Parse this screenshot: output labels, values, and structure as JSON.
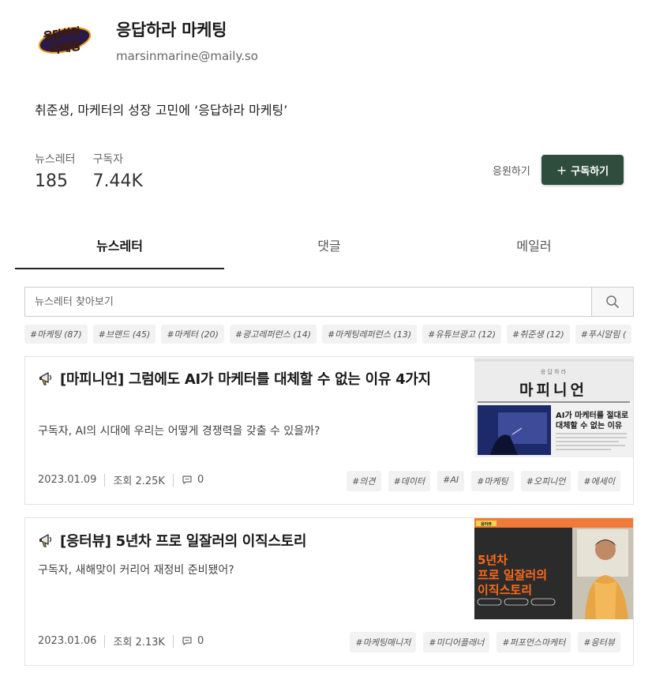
{
  "header": {
    "logo_text_line1": "응답하라",
    "logo_text_line2": "마케팅",
    "title": "응답하라 마케팅",
    "email": "marsinmarine@maily.so"
  },
  "description": "취준생, 마케터의 성장 고민에 ‘응답하라 마케팅’",
  "stats": {
    "newsletter_label": "뉴스레터",
    "newsletter_value": "185",
    "subscriber_label": "구독자",
    "subscriber_value": "7.44K"
  },
  "actions": {
    "support_label": "응원하기",
    "subscribe_plus": "+",
    "subscribe_label": "구독하기"
  },
  "tabs": [
    {
      "label": "뉴스레터"
    },
    {
      "label": "댓글"
    },
    {
      "label": "메일러"
    }
  ],
  "search": {
    "placeholder": "뉴스레터 찾아보기"
  },
  "tag_filters": [
    "#마케팅 (87)",
    "#브랜드 (45)",
    "#마케터 (20)",
    "#광고레퍼런스 (14)",
    "#마케팅레퍼런스 (13)",
    "#유튜브광고 (12)",
    "#취준생 (12)",
    "#푸시알림 ("
  ],
  "posts": [
    {
      "title": "[마피니언] 그럼에도 AI가 마케터를 대체할 수 없는 이유 4가지",
      "subtitle": "구독자, AI의 시대에 우리는 어떻게 경쟁력을 갖출 수 있을까?",
      "date": "2023.01.09",
      "views": "조회 2.25K",
      "comments": "0",
      "tags": [
        "#의견",
        "#데이터",
        "#AI",
        "#마케팅",
        "#오피니언",
        "#에세이"
      ],
      "thumb": {
        "header": "마피니언",
        "small": "응 답 하 라",
        "caption_line1": "AI가 마케터를 절대로",
        "caption_line2": "대체할 수 없는 이유"
      }
    },
    {
      "title": "[응터뷰] 5년차 프로 일잘러의 이직스토리",
      "subtitle": "구독자, 새해맞이 커리어 재정비 준비됐어?",
      "date": "2023.01.06",
      "views": "조회 2.13K",
      "comments": "0",
      "tags": [
        "#마케팅매니저",
        "#미디어플래너",
        "#퍼포먼스마케터",
        "#응터뷰"
      ],
      "thumb": {
        "badge": "응터뷰",
        "line1": "5년차",
        "line2": "프로 일잘러의",
        "line3": "이직스토리"
      }
    }
  ],
  "colors": {
    "subscribe_bg": "#2f4d3d",
    "thumb2_bg": "#2b2b2b",
    "thumb2_accent": "#f07a3a"
  }
}
